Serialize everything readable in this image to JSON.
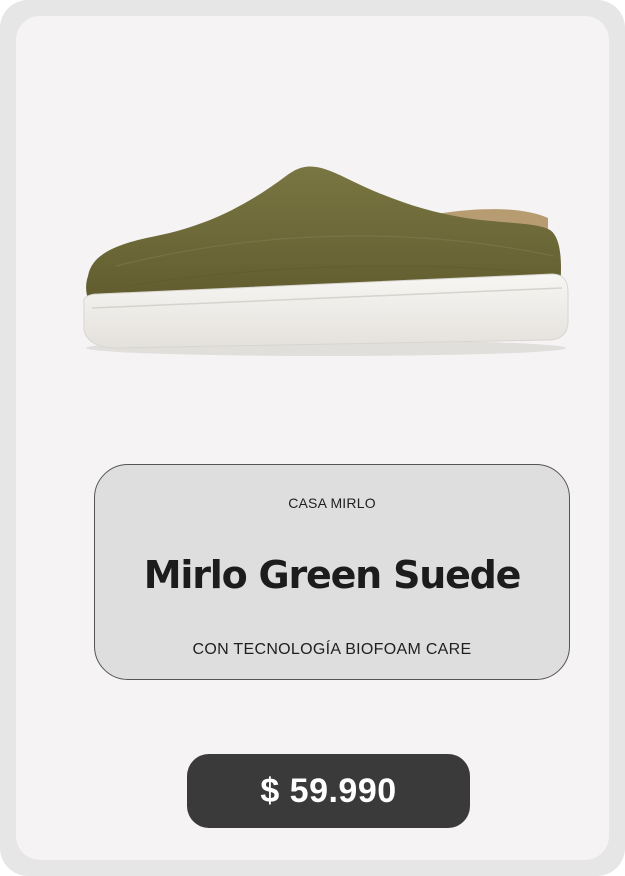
{
  "product": {
    "image_icon": "shoe-image",
    "brand": "CASA MIRLO",
    "name": "Mirlo Green Suede",
    "tagline": "CON TECNOLOGÍA BIOFOAM CARE",
    "price": "$ 59.990"
  },
  "colors": {
    "card_background": "#f5f3f4",
    "info_box_background": "#dedede",
    "price_pill_background": "#3a3a3a",
    "shoe_upper": "#6f6a38",
    "shoe_sole": "#f1efec"
  }
}
